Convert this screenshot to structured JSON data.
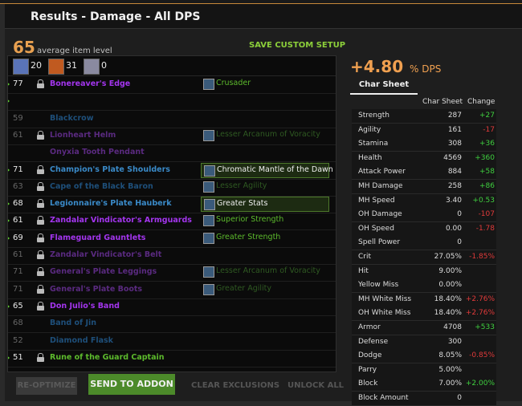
{
  "title": "Results - Damage - All DPS",
  "avg_ilvl": {
    "value": "65",
    "label": "average item level"
  },
  "save_custom_setup": "SAVE CUSTOM SETUP",
  "resistances": [
    {
      "icon": "frost-resistance-icon",
      "value": "20",
      "color": "#5a74b8"
    },
    {
      "icon": "fire-resistance-icon",
      "value": "31",
      "color": "#c05a20"
    },
    {
      "icon": "arcane-resistance-icon",
      "value": "0",
      "color": "#8a8aa0"
    }
  ],
  "items": [
    {
      "ilvl": "77",
      "name": "Bonereaver's Edge",
      "color": "#a335ee",
      "enchant": "Crusader",
      "ench_color": "#5cba2c",
      "dim": false,
      "marker": true,
      "locked": true,
      "ench_locked": true
    },
    {
      "ilvl": "",
      "name": "",
      "color": "#ddd",
      "enchant": "",
      "ench_color": "#ddd",
      "dim": false,
      "marker": true,
      "locked": false,
      "ench_locked": false
    },
    {
      "ilvl": "59",
      "name": "Blackcrow",
      "color": "#1e4f7a",
      "enchant": "",
      "ench_color": "#ddd",
      "dim": true,
      "marker": false,
      "locked": false,
      "ench_locked": false
    },
    {
      "ilvl": "61",
      "name": "Lionheart Helm",
      "color": "#5a2a80",
      "enchant": "Lesser Arcanum of Voracity",
      "ench_color": "#2f5a22",
      "dim": true,
      "marker": false,
      "locked": true,
      "ench_locked": true
    },
    {
      "ilvl": "",
      "name": "Onyxia Tooth Pendant",
      "color": "#5a2a80",
      "enchant": "",
      "ench_color": "#ddd",
      "dim": true,
      "marker": false,
      "locked": false,
      "ench_locked": false
    },
    {
      "ilvl": "71",
      "name": "Champion's Plate Shoulders",
      "color": "#3a8ac8",
      "enchant": "Chromatic Mantle of the Dawn",
      "ench_color": "#f0f0f0",
      "dim": false,
      "marker": true,
      "locked": true,
      "ench_locked": true,
      "ench_selected": true
    },
    {
      "ilvl": "63",
      "name": "Cape of the Black Baron",
      "color": "#1e4f7a",
      "enchant": "Lesser Agility",
      "ench_color": "#2f5a22",
      "dim": true,
      "marker": false,
      "locked": true,
      "ench_locked": true
    },
    {
      "ilvl": "68",
      "name": "Legionnaire's Plate Hauberk",
      "color": "#3a8ac8",
      "enchant": "Greater Stats",
      "ench_color": "#f0f0f0",
      "dim": false,
      "marker": true,
      "locked": true,
      "ench_locked": true,
      "ench_selected": true
    },
    {
      "ilvl": "61",
      "name": "Zandalar Vindicator's Armguards",
      "color": "#a335ee",
      "enchant": "Superior Strength",
      "ench_color": "#5cba2c",
      "dim": false,
      "marker": true,
      "locked": true,
      "ench_locked": true
    },
    {
      "ilvl": "69",
      "name": "Flameguard Gauntlets",
      "color": "#a335ee",
      "enchant": "Greater Strength",
      "ench_color": "#5cba2c",
      "dim": false,
      "marker": true,
      "locked": true,
      "ench_locked": true
    },
    {
      "ilvl": "61",
      "name": "Zandalar Vindicator's Belt",
      "color": "#5a2a80",
      "enchant": "",
      "ench_color": "#ddd",
      "dim": true,
      "marker": false,
      "locked": true,
      "ench_locked": false
    },
    {
      "ilvl": "71",
      "name": "General's Plate Leggings",
      "color": "#5a2a80",
      "enchant": "Lesser Arcanum of Voracity",
      "ench_color": "#2f5a22",
      "dim": true,
      "marker": false,
      "locked": true,
      "ench_locked": true
    },
    {
      "ilvl": "71",
      "name": "General's Plate Boots",
      "color": "#5a2a80",
      "enchant": "Greater Agility",
      "ench_color": "#2f5a22",
      "dim": true,
      "marker": false,
      "locked": true,
      "ench_locked": true
    },
    {
      "ilvl": "65",
      "name": "Don Julio's Band",
      "color": "#a335ee",
      "enchant": "",
      "ench_color": "#ddd",
      "dim": false,
      "marker": true,
      "locked": true,
      "ench_locked": false
    },
    {
      "ilvl": "68",
      "name": "Band of Jin",
      "color": "#1e4f7a",
      "enchant": "",
      "ench_color": "#ddd",
      "dim": true,
      "marker": false,
      "locked": false,
      "ench_locked": false
    },
    {
      "ilvl": "52",
      "name": "Diamond Flask",
      "color": "#1e4f7a",
      "enchant": "",
      "ench_color": "#ddd",
      "dim": true,
      "marker": false,
      "locked": false,
      "ench_locked": false
    },
    {
      "ilvl": "51",
      "name": "Rune of the Guard Captain",
      "color": "#5cba2c",
      "enchant": "",
      "ench_color": "#ddd",
      "dim": false,
      "marker": true,
      "locked": true,
      "ench_locked": false
    }
  ],
  "dps_change": {
    "value": "+4.80",
    "label": "% DPS"
  },
  "char_sheet_tab": "Char Sheet",
  "stats_header": {
    "col1": "Char Sheet",
    "col2": "Change"
  },
  "stats": [
    {
      "label": "Strength",
      "value": "287",
      "change": "+27",
      "pos": "pos"
    },
    {
      "label": "Agility",
      "value": "161",
      "change": "-17",
      "pos": "neg"
    },
    {
      "label": "Stamina",
      "value": "308",
      "change": "+36",
      "pos": "pos"
    },
    {
      "label": "Health",
      "value": "4569",
      "change": "+360",
      "pos": "pos"
    },
    {
      "label": "Attack Power",
      "value": "884",
      "change": "+58",
      "pos": "pos"
    },
    {
      "label": "MH Damage",
      "value": "258",
      "change": "+86",
      "pos": "pos"
    },
    {
      "label": "MH Speed",
      "value": "3.40",
      "change": "+0.53",
      "pos": "pos"
    },
    {
      "label": "OH Damage",
      "value": "0",
      "change": "-107",
      "pos": "neg"
    },
    {
      "label": "OH Speed",
      "value": "0.00",
      "change": "-1.78",
      "pos": "neg"
    },
    {
      "label": "Spell Power",
      "value": "0",
      "change": "",
      "pos": "none"
    },
    {
      "label": "Crit",
      "value": "27.05%",
      "change": "-1.85%",
      "pos": "neg"
    },
    {
      "label": "Hit",
      "value": "9.00%",
      "change": "",
      "pos": "none"
    },
    {
      "label": "Yellow Miss",
      "value": "0.00%",
      "change": "",
      "pos": "none"
    },
    {
      "label": "MH White Miss",
      "value": "18.40%",
      "change": "+2.76%",
      "pos": "neg"
    },
    {
      "label": "OH White Miss",
      "value": "18.40%",
      "change": "+2.76%",
      "pos": "neg"
    },
    {
      "label": "Armor",
      "value": "4708",
      "change": "+533",
      "pos": "pos"
    },
    {
      "label": "Defense",
      "value": "300",
      "change": "",
      "pos": "none"
    },
    {
      "label": "Dodge",
      "value": "8.05%",
      "change": "-0.85%",
      "pos": "neg"
    },
    {
      "label": "Parry",
      "value": "5.00%",
      "change": "",
      "pos": "none"
    },
    {
      "label": "Block",
      "value": "7.00%",
      "change": "+2.00%",
      "pos": "pos"
    },
    {
      "label": "Block Amount",
      "value": "0",
      "change": "",
      "pos": "none"
    }
  ],
  "buttons": {
    "reoptimize": "RE-OPTIMIZE",
    "send": "SEND TO ADDON",
    "clear": "CLEAR EXCLUSIONS",
    "unlock": "UNLOCK ALL"
  },
  "colors": {
    "pos": "#3fcf3f",
    "neg": "#e03a3a",
    "accent": "#f0a050"
  }
}
